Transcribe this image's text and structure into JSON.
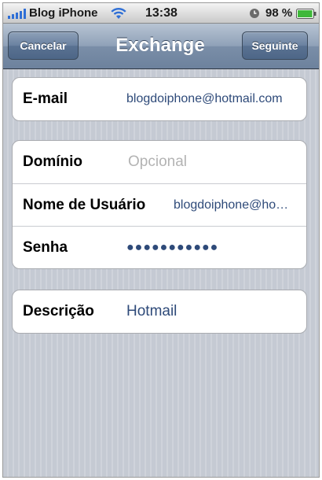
{
  "status_bar": {
    "carrier": "Blog iPhone",
    "time": "13:38",
    "battery_percent": "98 %",
    "battery_level": 0.98,
    "icons": [
      "signal-icon",
      "wifi-icon",
      "alarm-icon",
      "battery-icon"
    ]
  },
  "nav": {
    "cancel_label": "Cancelar",
    "title": "Exchange",
    "next_label": "Seguinte"
  },
  "form": {
    "email": {
      "label": "E-mail",
      "value": "blogdoiphone@hotmail.com"
    },
    "domain": {
      "label": "Domínio",
      "placeholder": "Opcional"
    },
    "username": {
      "label": "Nome de Usuário",
      "value": "blogdoiphone@ho…"
    },
    "password": {
      "label": "Senha",
      "value": "●●●●●●●●●●●"
    },
    "description": {
      "label": "Descrição",
      "value": "Hotmail"
    }
  },
  "colors": {
    "value_text": "#2e4a79",
    "nav_bar": "#7a8ea8",
    "background": "#c8ccd5"
  }
}
